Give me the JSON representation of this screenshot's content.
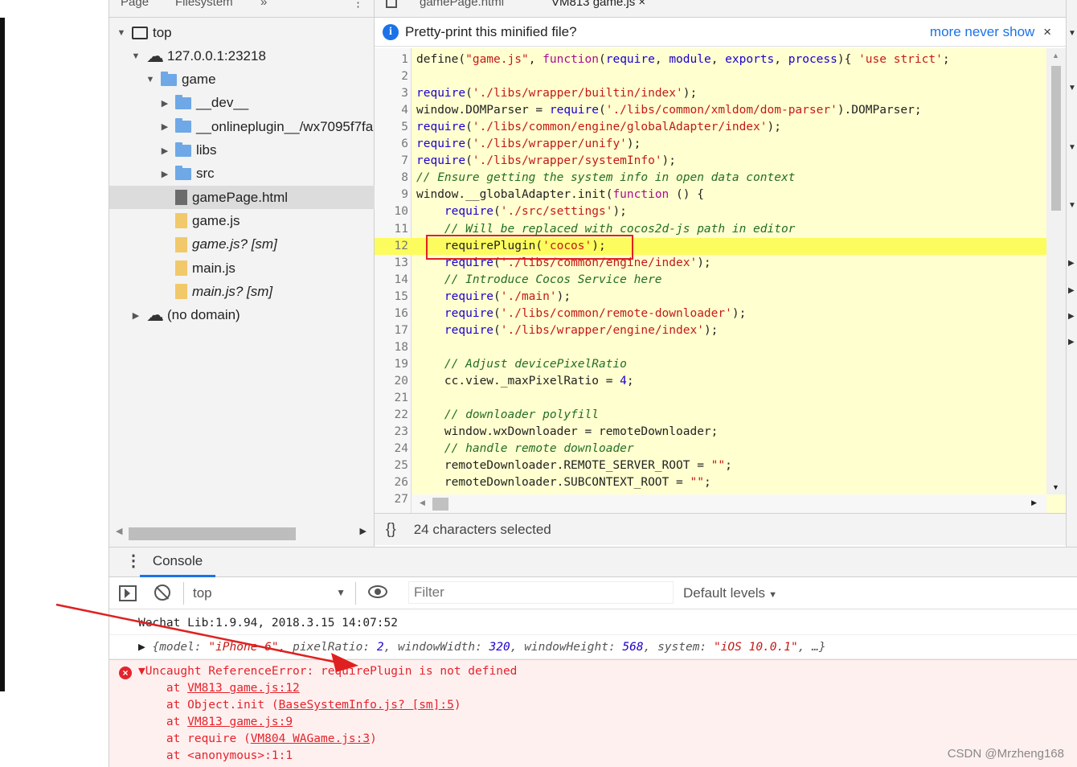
{
  "navigator": {
    "tabs": [
      "Page",
      "Filesystem",
      "»",
      "⋮"
    ],
    "tree": [
      {
        "label": "top",
        "indent": 0,
        "toggle": "▼",
        "icon": "frame-icon",
        "selected": false,
        "italic": false
      },
      {
        "label": "127.0.0.1:23218",
        "indent": 1,
        "toggle": "▼",
        "icon": "cloud-icon",
        "selected": false,
        "italic": false
      },
      {
        "label": "game",
        "indent": 2,
        "toggle": "▼",
        "icon": "folder-icon",
        "selected": false,
        "italic": false
      },
      {
        "label": "__dev__",
        "indent": 3,
        "toggle": "▶",
        "icon": "folder-icon",
        "selected": false,
        "italic": false
      },
      {
        "label": "__onlineplugin__/wx7095f7fa",
        "indent": 3,
        "toggle": "▶",
        "icon": "folder-icon",
        "selected": false,
        "italic": false
      },
      {
        "label": "libs",
        "indent": 3,
        "toggle": "▶",
        "icon": "folder-icon",
        "selected": false,
        "italic": false
      },
      {
        "label": "src",
        "indent": 3,
        "toggle": "▶",
        "icon": "folder-icon",
        "selected": false,
        "italic": false
      },
      {
        "label": "gamePage.html",
        "indent": 3,
        "toggle": "",
        "icon": "html-file-icon",
        "selected": true,
        "italic": false
      },
      {
        "label": "game.js",
        "indent": 3,
        "toggle": "",
        "icon": "js-file-icon",
        "selected": false,
        "italic": false
      },
      {
        "label": "game.js? [sm]",
        "indent": 3,
        "toggle": "",
        "icon": "js-file-icon",
        "selected": false,
        "italic": true
      },
      {
        "label": "main.js",
        "indent": 3,
        "toggle": "",
        "icon": "js-file-icon",
        "selected": false,
        "italic": false
      },
      {
        "label": "main.js? [sm]",
        "indent": 3,
        "toggle": "",
        "icon": "js-file-icon",
        "selected": false,
        "italic": true
      },
      {
        "label": "(no domain)",
        "indent": 1,
        "toggle": "▶",
        "icon": "cloud-icon",
        "selected": false,
        "italic": false
      }
    ]
  },
  "editor": {
    "tabs": [
      "gamePage.html",
      "VM813 game.js ×"
    ],
    "infobar": {
      "message": "Pretty-print this minified file?",
      "more": "more",
      "never_show": "never show",
      "close": "×"
    },
    "lines": [
      [
        {
          "t": "define(",
          "c": ""
        },
        {
          "t": "\"game.js\"",
          "c": "str"
        },
        {
          "t": ", ",
          "c": ""
        },
        {
          "t": "function",
          "c": "kw"
        },
        {
          "t": "(",
          "c": ""
        },
        {
          "t": "require",
          "c": "fn"
        },
        {
          "t": ", ",
          "c": ""
        },
        {
          "t": "module",
          "c": "fn"
        },
        {
          "t": ", ",
          "c": ""
        },
        {
          "t": "exports",
          "c": "fn"
        },
        {
          "t": ", ",
          "c": ""
        },
        {
          "t": "process",
          "c": "fn"
        },
        {
          "t": "){ ",
          "c": ""
        },
        {
          "t": "'use strict'",
          "c": "str"
        },
        {
          "t": ";",
          "c": ""
        }
      ],
      [],
      [
        {
          "t": "require",
          "c": "fn"
        },
        {
          "t": "(",
          "c": ""
        },
        {
          "t": "'./libs/wrapper/builtin/index'",
          "c": "str"
        },
        {
          "t": ");",
          "c": ""
        }
      ],
      [
        {
          "t": "window.DOMParser = ",
          "c": ""
        },
        {
          "t": "require",
          "c": "fn"
        },
        {
          "t": "(",
          "c": ""
        },
        {
          "t": "'./libs/common/xmldom/dom-parser'",
          "c": "str"
        },
        {
          "t": ").DOMParser;",
          "c": ""
        }
      ],
      [
        {
          "t": "require",
          "c": "fn"
        },
        {
          "t": "(",
          "c": ""
        },
        {
          "t": "'./libs/common/engine/globalAdapter/index'",
          "c": "str"
        },
        {
          "t": ");",
          "c": ""
        }
      ],
      [
        {
          "t": "require",
          "c": "fn"
        },
        {
          "t": "(",
          "c": ""
        },
        {
          "t": "'./libs/wrapper/unify'",
          "c": "str"
        },
        {
          "t": ");",
          "c": ""
        }
      ],
      [
        {
          "t": "require",
          "c": "fn"
        },
        {
          "t": "(",
          "c": ""
        },
        {
          "t": "'./libs/wrapper/systemInfo'",
          "c": "str"
        },
        {
          "t": ");",
          "c": ""
        }
      ],
      [
        {
          "t": "// Ensure getting the system info in open data context",
          "c": "cm"
        }
      ],
      [
        {
          "t": "window.__globalAdapter.init(",
          "c": ""
        },
        {
          "t": "function",
          "c": "kw"
        },
        {
          "t": " () {",
          "c": ""
        }
      ],
      [
        {
          "t": "    ",
          "c": ""
        },
        {
          "t": "require",
          "c": "fn"
        },
        {
          "t": "(",
          "c": ""
        },
        {
          "t": "'./src/settings'",
          "c": "str"
        },
        {
          "t": ");",
          "c": ""
        }
      ],
      [
        {
          "t": "    // Will be replaced with cocos2d-js path in editor",
          "c": "cm"
        }
      ],
      [
        {
          "t": "    requirePlugin(",
          "c": ""
        },
        {
          "t": "'cocos'",
          "c": "str"
        },
        {
          "t": ");",
          "c": ""
        }
      ],
      [
        {
          "t": "    ",
          "c": ""
        },
        {
          "t": "require",
          "c": "fn"
        },
        {
          "t": "(",
          "c": ""
        },
        {
          "t": "'./libs/common/engine/index'",
          "c": "str"
        },
        {
          "t": ");",
          "c": ""
        }
      ],
      [
        {
          "t": "    // Introduce Cocos Service here",
          "c": "cm"
        }
      ],
      [
        {
          "t": "    ",
          "c": ""
        },
        {
          "t": "require",
          "c": "fn"
        },
        {
          "t": "(",
          "c": ""
        },
        {
          "t": "'./main'",
          "c": "str"
        },
        {
          "t": ");",
          "c": ""
        }
      ],
      [
        {
          "t": "    ",
          "c": ""
        },
        {
          "t": "require",
          "c": "fn"
        },
        {
          "t": "(",
          "c": ""
        },
        {
          "t": "'./libs/common/remote-downloader'",
          "c": "str"
        },
        {
          "t": ");",
          "c": ""
        }
      ],
      [
        {
          "t": "    ",
          "c": ""
        },
        {
          "t": "require",
          "c": "fn"
        },
        {
          "t": "(",
          "c": ""
        },
        {
          "t": "'./libs/wrapper/engine/index'",
          "c": "str"
        },
        {
          "t": ");",
          "c": ""
        }
      ],
      [],
      [
        {
          "t": "    // Adjust devicePixelRatio",
          "c": "cm"
        }
      ],
      [
        {
          "t": "    cc.view._maxPixelRatio = ",
          "c": ""
        },
        {
          "t": "4",
          "c": "num"
        },
        {
          "t": ";",
          "c": ""
        }
      ],
      [],
      [
        {
          "t": "    // downloader polyfill",
          "c": "cm"
        }
      ],
      [
        {
          "t": "    window.wxDownloader = remoteDownloader;",
          "c": ""
        }
      ],
      [
        {
          "t": "    // handle remote downloader",
          "c": "cm"
        }
      ],
      [
        {
          "t": "    remoteDownloader.REMOTE_SERVER_ROOT = ",
          "c": ""
        },
        {
          "t": "\"\"",
          "c": "str"
        },
        {
          "t": ";",
          "c": ""
        }
      ],
      [
        {
          "t": "    remoteDownloader.SUBCONTEXT_ROOT = ",
          "c": ""
        },
        {
          "t": "\"\"",
          "c": "str"
        },
        {
          "t": ";",
          "c": ""
        }
      ],
      [
        {
          "t": "    ",
          "c": ""
        }
      ]
    ],
    "highlight_line": 12,
    "status": {
      "braces": "{}",
      "selection": "24 characters selected"
    }
  },
  "console": {
    "tab_label": "Console",
    "context": "top",
    "filter_placeholder": "Filter",
    "levels": "Default levels",
    "log_line": "Wechat Lib:1.9.94, 2018.3.15 14:07:52",
    "object_line": [
      {
        "t": "▶ ",
        "c": ""
      },
      {
        "t": "{model: ",
        "c": "obj-key"
      },
      {
        "t": "\"iPhone 6\"",
        "c": "obj-str"
      },
      {
        "t": ", pixelRatio: ",
        "c": "obj-key"
      },
      {
        "t": "2",
        "c": "obj-num"
      },
      {
        "t": ", windowWidth: ",
        "c": "obj-key"
      },
      {
        "t": "320",
        "c": "obj-num"
      },
      {
        "t": ", windowHeight: ",
        "c": "obj-key"
      },
      {
        "t": "568",
        "c": "obj-num"
      },
      {
        "t": ", system: ",
        "c": "obj-key"
      },
      {
        "t": "\"iOS 10.0.1\"",
        "c": "obj-str"
      },
      {
        "t": ", …}",
        "c": "obj-key"
      }
    ],
    "error": {
      "message": "▼Uncaught ReferenceError: requirePlugin is not defined",
      "stack": [
        {
          "prefix": "    at ",
          "link": "VM813 game.js:12",
          "suffix": ""
        },
        {
          "prefix": "    at Object.init (",
          "link": "BaseSystemInfo.js? [sm]:5",
          "suffix": ")"
        },
        {
          "prefix": "    at ",
          "link": "VM813 game.js:9",
          "suffix": ""
        },
        {
          "prefix": "    at require (",
          "link": "VM804 WAGame.js:3",
          "suffix": ")"
        },
        {
          "prefix": "    at <anonymous>:1:1",
          "link": "",
          "suffix": ""
        }
      ]
    }
  },
  "watermark": "CSDN @Mrzheng168",
  "colors": {
    "annotation_red": "#e02020",
    "link_blue": "#1a73e8",
    "error_red": "#e3242b"
  }
}
